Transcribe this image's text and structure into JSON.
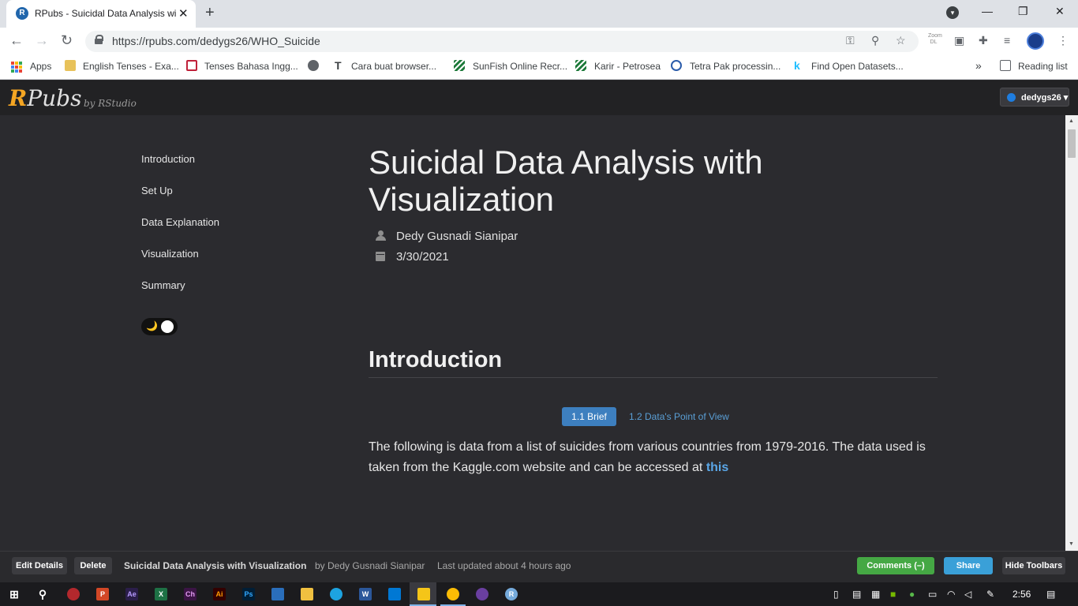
{
  "browser": {
    "tab_title": "RPubs - Suicidal Data Analysis wi",
    "tab_favicon": "R",
    "tab_close": "✕",
    "new_tab": "+",
    "url": "https://rpubs.com/dedygs26/WHO_Suicide",
    "zoom_dl": "Zoom DL",
    "back": "←",
    "forward": "→",
    "reload": "↻",
    "minimize": "—",
    "restore": "❐",
    "close": "✕",
    "tab_search": "▾"
  },
  "bookmarks": {
    "items": [
      {
        "label": "Apps"
      },
      {
        "label": "English Tenses - Exa..."
      },
      {
        "label": "Tenses Bahasa Ingg..."
      },
      {
        "label": ""
      },
      {
        "label": "Cara buat browser..."
      },
      {
        "label": "SunFish Online Recr..."
      },
      {
        "label": "Karir - Petrosea"
      },
      {
        "label": "Tetra Pak processin..."
      },
      {
        "label": "Find Open Datasets..."
      }
    ],
    "overflow": "»",
    "reading_list": "Reading list"
  },
  "rpubs": {
    "logo_r": "R",
    "logo_rest": "Pubs",
    "byline": "by RStudio",
    "user": "dedygs26 ▾"
  },
  "toc": {
    "items": [
      "Introduction",
      "Set Up",
      "Data Explanation",
      "Visualization",
      "Summary"
    ]
  },
  "toggle": {
    "moon": "🌙"
  },
  "article": {
    "title": "Suicidal Data Analysis with Visualization",
    "author": "Dedy Gusnadi Sianipar",
    "date": "3/30/2021",
    "section_heading": "Introduction",
    "tab_active": "1.1 Brief",
    "tab_other": "1.2 Data's Point of View",
    "paragraph": "The following is data from a list of suicides from various countries from 1979-2016. The data used is taken from the Kaggle.com website and can be accessed at ",
    "link_text": "this"
  },
  "footer": {
    "edit_details": "Edit Details",
    "delete": "Delete",
    "doc_title": "Suicidal Data Analysis with Visualization",
    "by_author": "by Dedy Gusnadi Sianipar",
    "last_updated": "Last updated about 4 hours ago",
    "comments": "Comments (–)",
    "share": "Share",
    "hide_toolbars": "Hide Toolbars"
  },
  "taskbar": {
    "clock": "2:56"
  },
  "colors": {
    "accent_orange": "#f5a623",
    "link_blue": "#5aa7e8",
    "active_pill": "#3d7fbf",
    "comments_green": "#45a844",
    "share_blue": "#3aa0d8",
    "page_bg": "#2b2b2f"
  }
}
